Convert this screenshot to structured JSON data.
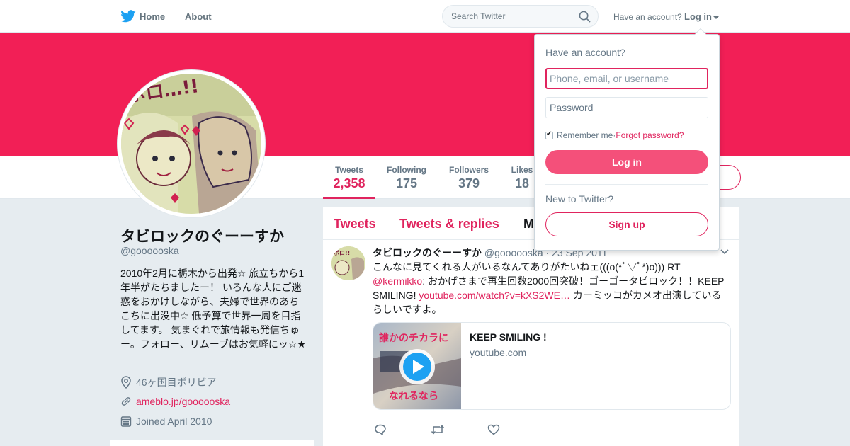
{
  "colors": {
    "accent": "#e0245e",
    "banner": "#f21f56",
    "brand": "#1da1f2",
    "muted": "#657786"
  },
  "nav": {
    "home_label": "Home",
    "about_label": "About",
    "search_placeholder": "Search Twitter",
    "have_account": "Have an account?",
    "login_label": "Log in"
  },
  "profile": {
    "name": "タビロックのぐーーすか",
    "handle": "@goooooska",
    "bio": "2010年2月に栃木から出発☆ 旅立ちから1年半がたちましたー！ いろんな人にご迷惑をおかけしながら、夫婦で世界のあちこちに出没中☆ 低予算で世界一周を目指してます。 気まぐれで旅情報も発信ちゅー。フォロー、リムーブはお気軽にッ☆★",
    "location": "46ヶ国目ボリビア",
    "url": "ameblo.jp/goooooska",
    "joined": "Joined April 2010"
  },
  "stats": [
    {
      "label": "Tweets",
      "value": "2,358"
    },
    {
      "label": "Following",
      "value": "175"
    },
    {
      "label": "Followers",
      "value": "379"
    },
    {
      "label": "Likes",
      "value": "18"
    }
  ],
  "timeline": {
    "tabs": [
      "Tweets",
      "Tweets & replies",
      "M"
    ]
  },
  "tweet": {
    "name": "タビロックのぐーーすか",
    "handle": "@goooooska",
    "date": "· 23 Sep 2011",
    "text_1": "こんなに見てくれる人がいるなんてありがたいねェ(((o(*ﾟ▽ﾟ*)o))) RT ",
    "mention": "@kermikko",
    "text_2": ": おかげさまで再生回数2000回突破！ゴーゴータビロック！！KEEP SMILING! ",
    "link": "youtube.com/watch?v=kXS2WE…",
    "text_3": " カーミッコがカメオ出演しているらしいですよ。",
    "card": {
      "title": "KEEP SMILING !",
      "domain": "youtube.com",
      "thumb_top": "誰かのチカラに",
      "thumb_bottom": "なれるなら"
    }
  },
  "login_dropdown": {
    "title": "Have an account?",
    "username_placeholder": "Phone, email, or username",
    "password_placeholder": "Password",
    "remember": "Remember me",
    "separator": " · ",
    "forgot": "Forgot password?",
    "login_button": "Log in",
    "new_to": "New to Twitter?",
    "signup_button": "Sign up"
  }
}
